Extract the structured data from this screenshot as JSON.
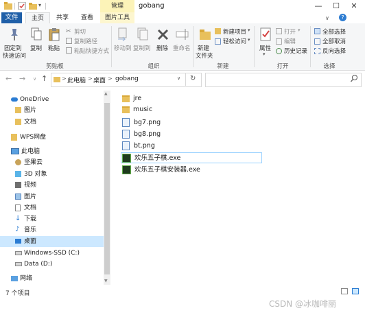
{
  "window": {
    "title": "gobang",
    "manage_tab": "管理",
    "controls": {
      "minimize": "—",
      "maximize": "☐",
      "close": "✕"
    }
  },
  "ribbon_tabs": [
    {
      "label": "文件"
    },
    {
      "label": "主页"
    },
    {
      "label": "共享"
    },
    {
      "label": "查看"
    },
    {
      "label": "图片工具"
    }
  ],
  "ribbon": {
    "clipboard": {
      "caption": "剪贴板",
      "pin_quick": "固定到\n快速访问",
      "pin_quick_1": "固定到",
      "pin_quick_2": "快速访问",
      "copy": "复制",
      "paste": "粘贴",
      "cut": "剪切",
      "copy_path": "复制路径",
      "paste_shortcut": "粘贴快捷方式"
    },
    "organize": {
      "caption": "组织",
      "move_to": "移动到",
      "copy_to": "复制到",
      "delete": "删除",
      "rename": "重命名"
    },
    "new": {
      "caption": "新建",
      "new_folder_1": "新建",
      "new_folder_2": "文件夹",
      "new_item": "新建项目",
      "easy_access": "轻松访问"
    },
    "open": {
      "caption": "打开",
      "properties": "属性",
      "open": "打开",
      "edit": "编辑",
      "history": "历史记录"
    },
    "select": {
      "caption": "选择",
      "select_all": "全部选择",
      "select_none": "全部取消",
      "invert": "反向选择"
    }
  },
  "address": {
    "crumbs": [
      "此电脑",
      "桌面",
      "gobang"
    ],
    "separator": ">"
  },
  "nav": {
    "items": [
      {
        "label": "OneDrive"
      },
      {
        "label": "图片"
      },
      {
        "label": "文档"
      },
      {
        "label": "WPS网盘"
      },
      {
        "label": "此电脑"
      },
      {
        "label": "坚果云"
      },
      {
        "label": "3D 对象"
      },
      {
        "label": "视频"
      },
      {
        "label": "图片"
      },
      {
        "label": "文档"
      },
      {
        "label": "下载"
      },
      {
        "label": "音乐"
      },
      {
        "label": "桌面"
      },
      {
        "label": "Windows-SSD (C:)"
      },
      {
        "label": "Data (D:)"
      },
      {
        "label": "网络"
      }
    ]
  },
  "files": [
    {
      "name": "jre",
      "type": "folder"
    },
    {
      "name": "music",
      "type": "folder"
    },
    {
      "name": "bg7.png",
      "type": "png"
    },
    {
      "name": "bg8.png",
      "type": "png"
    },
    {
      "name": "bt.png",
      "type": "png"
    },
    {
      "name": "欢乐五子棋.exe",
      "type": "exe"
    },
    {
      "name": "欢乐五子棋安装器.exe",
      "type": "exe"
    }
  ],
  "status": {
    "count": "7 个项目"
  },
  "watermark": "CSDN @冰咖啡丽",
  "colors": {
    "file_tab": "#1f5fa8",
    "selection": "#cce8ff",
    "manage_tab": "#fcf3b8"
  }
}
